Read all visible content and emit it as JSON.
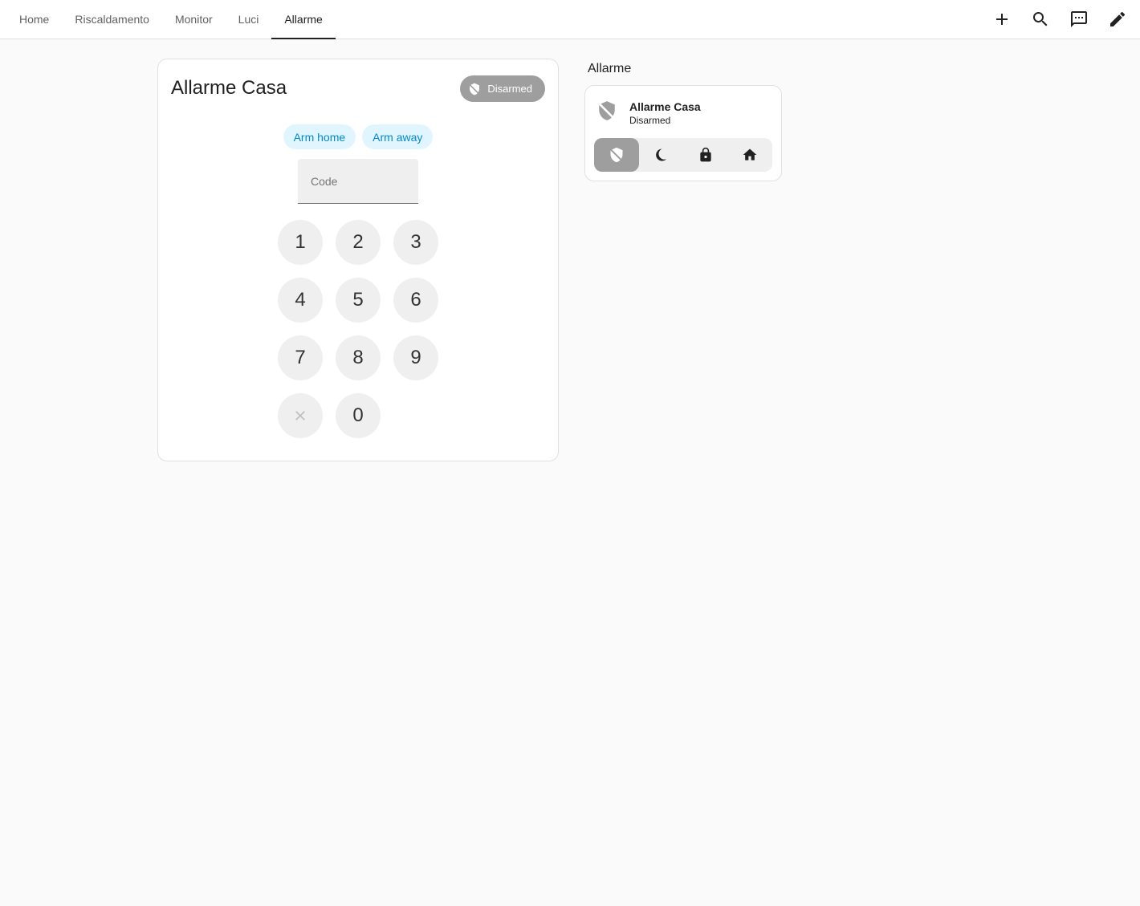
{
  "header": {
    "tabs": [
      {
        "label": "Home"
      },
      {
        "label": "Riscaldamento"
      },
      {
        "label": "Monitor"
      },
      {
        "label": "Luci"
      },
      {
        "label": "Allarme"
      }
    ],
    "active_tab": "Allarme",
    "actions": [
      {
        "icon": "plus-icon"
      },
      {
        "icon": "search-icon"
      },
      {
        "icon": "assist-chat-icon"
      },
      {
        "icon": "pencil-icon"
      }
    ]
  },
  "alarm_panel": {
    "title": "Allarme Casa",
    "state": "Disarmed",
    "state_color": "#9e9e9e",
    "arm_buttons": [
      {
        "label": "Arm home"
      },
      {
        "label": "Arm away"
      }
    ],
    "code_placeholder": "Code",
    "code_value": "",
    "keys": [
      "1",
      "2",
      "3",
      "4",
      "5",
      "6",
      "7",
      "8",
      "9",
      "clear",
      "0"
    ]
  },
  "section": {
    "title": "Allarme",
    "tile": {
      "name": "Allarme Casa",
      "state": "Disarmed",
      "icon": "shield-off-icon",
      "modes": [
        {
          "icon": "shield-off-icon",
          "active": true
        },
        {
          "icon": "moon-icon",
          "active": false
        },
        {
          "icon": "lock-icon",
          "active": false
        },
        {
          "icon": "home-icon",
          "active": false
        }
      ]
    }
  },
  "colors": {
    "accent": "#0288d1",
    "accent_bg": "#e1f5fe",
    "disarmed": "#9e9e9e"
  }
}
